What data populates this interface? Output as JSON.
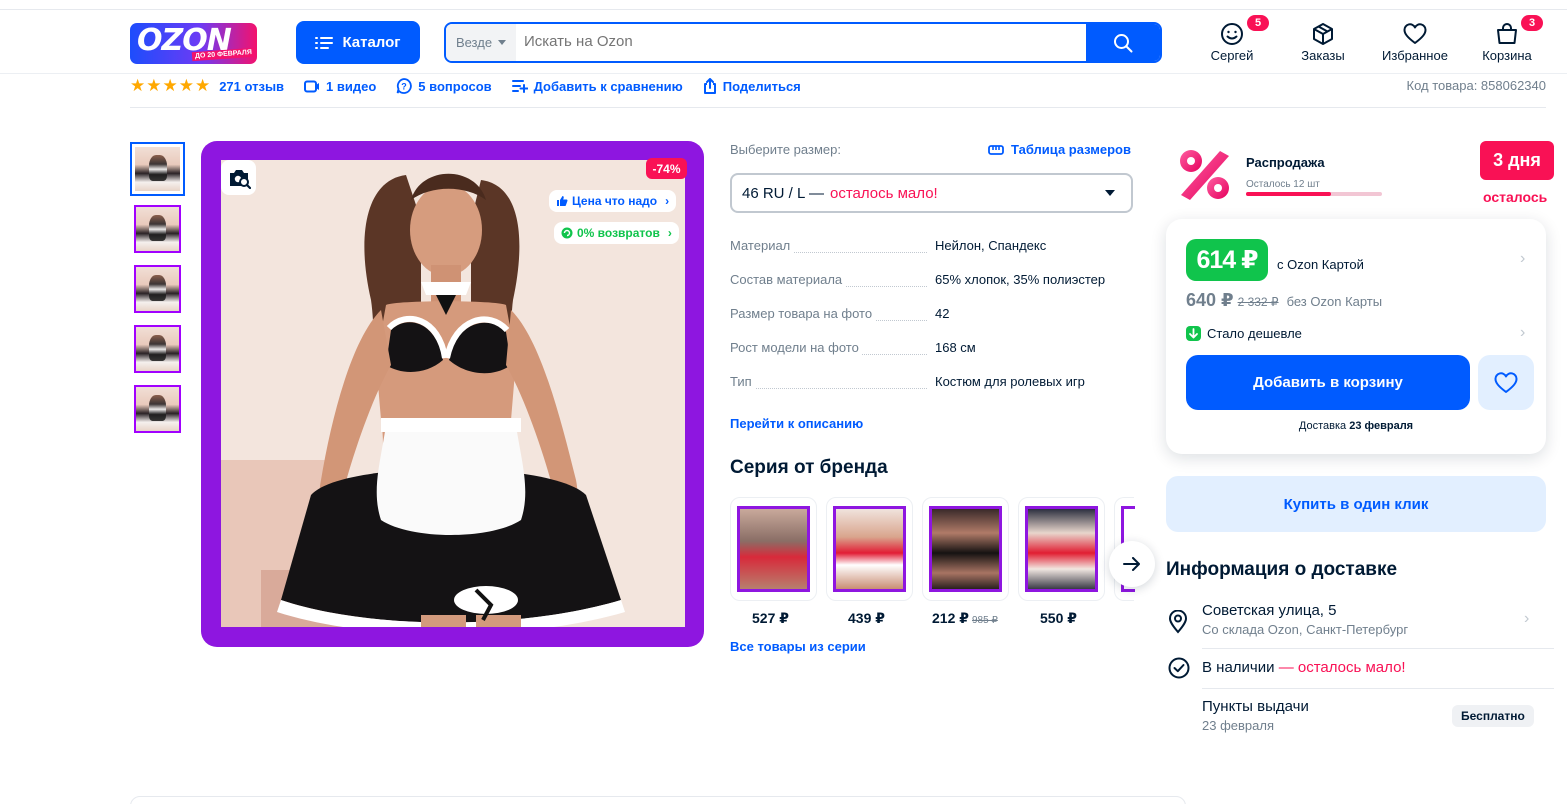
{
  "header": {
    "logo_text": "OZON",
    "logo_sub": "ДО 20 ФЕВРАЛЯ",
    "catalog_label": "Каталог",
    "search_scope": "Везде",
    "search_placeholder": "Искать на Ozon",
    "nav": [
      {
        "label": "Сергей",
        "icon": "smile-icon",
        "badge": "5"
      },
      {
        "label": "Заказы",
        "icon": "box-icon",
        "badge": ""
      },
      {
        "label": "Избранное",
        "icon": "heart-icon",
        "badge": ""
      },
      {
        "label": "Корзина",
        "icon": "cart-icon",
        "badge": "3"
      }
    ]
  },
  "meta": {
    "rating": 5,
    "reviews": "271 отзыв",
    "video": "1 видео",
    "questions": "5 вопросов",
    "compare": "Добавить к сравнению",
    "share": "Поделиться",
    "code": "Код товара: 858062340"
  },
  "gallery": {
    "discount": "-74%",
    "chip_price": "Цена что надо",
    "chip_returns": "0% возвратов",
    "thumbs": 5
  },
  "options": {
    "size_label": "Выберите размер:",
    "size_table": "Таблица размеров",
    "selected_size": "46 RU / L —",
    "size_warning": "осталось мало!",
    "specs": [
      {
        "k": "Материал",
        "v": "Нейлон, Спандекс"
      },
      {
        "k": "Состав материала",
        "v": "65% хлопок, 35% полиэстер"
      },
      {
        "k": "Размер товара на фото",
        "v": "42"
      },
      {
        "k": "Рост модели на фото",
        "v": "168 см"
      },
      {
        "k": "Тип",
        "v": "Костюм для ролевых игр"
      }
    ],
    "to_description": "Перейти к описанию"
  },
  "series": {
    "title": "Серия от бренда",
    "items": [
      {
        "price": "527 ₽",
        "old": ""
      },
      {
        "price": "439 ₽",
        "old": ""
      },
      {
        "price": "212 ₽",
        "old": "985 ₽"
      },
      {
        "price": "550 ₽",
        "old": ""
      }
    ],
    "all_link": "Все товары из серии"
  },
  "sale": {
    "title": "Распродажа",
    "left": "Осталось 12 шт",
    "days": "3 дня",
    "days_sub": "осталось"
  },
  "price": {
    "card_price": "614 ₽",
    "card_label": "с Ozon Картой",
    "price": "640 ₽",
    "old_price": "2 332 ₽",
    "no_card": "без Ozon Карты",
    "cheaper": "Стало дешевле",
    "add_to_cart": "Добавить в корзину",
    "delivery_label": "Доставка",
    "delivery_date": "23 февраля",
    "one_click": "Купить в один клик"
  },
  "delivery_info": {
    "title": "Информация о доставке",
    "address": "Советская улица, 5",
    "warehouse": "Со склада Ozon, Санкт-Петербург",
    "stock": "В наличии",
    "stock_warn": "— осталось мало!",
    "pickup": "Пункты выдачи",
    "pickup_date": "23 февраля",
    "free": "Бесплатно"
  },
  "colors": {
    "accent": "#005bff",
    "pink": "#f91155",
    "green": "#10c44c",
    "purple": "#8e16e0"
  }
}
